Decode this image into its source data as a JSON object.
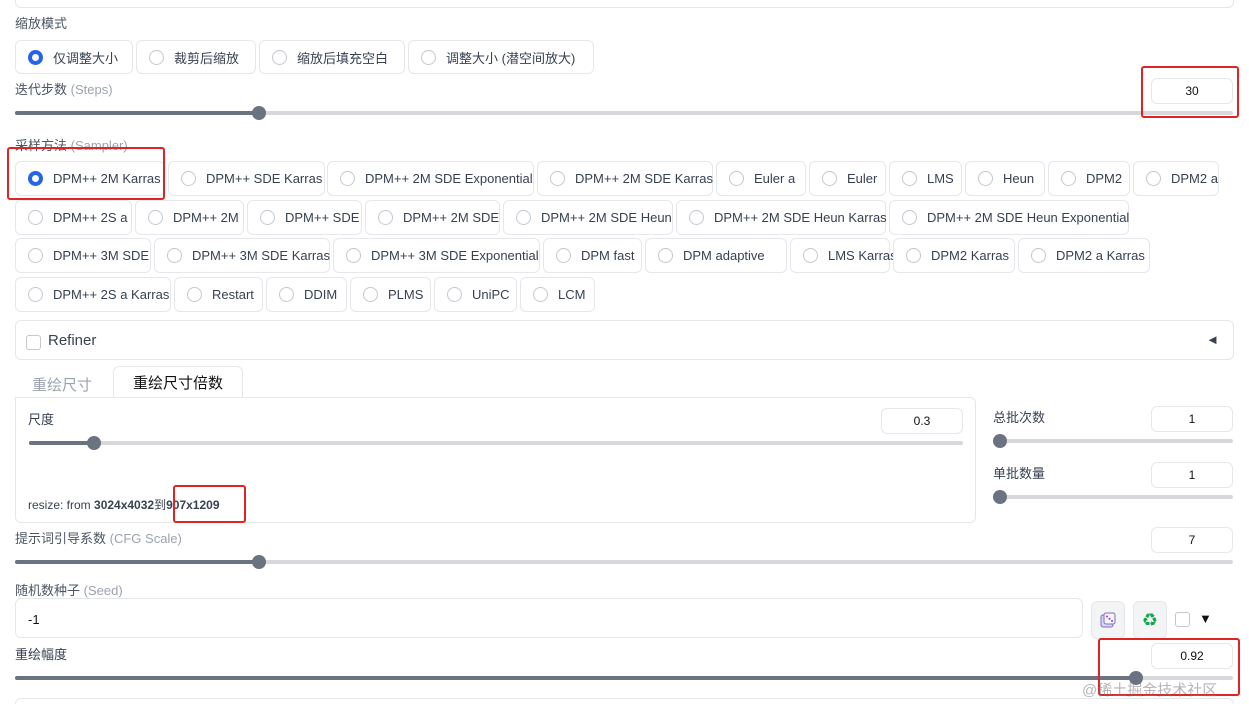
{
  "resize_mode": {
    "label": "缩放模式",
    "options": [
      "仅调整大小",
      "裁剪后缩放",
      "缩放后填充空白",
      "调整大小 (潜空间放大)"
    ],
    "selected": 0
  },
  "steps": {
    "label": "迭代步数",
    "label_en": "(Steps)",
    "value": "30",
    "fraction": 0.2
  },
  "sampler": {
    "label": "采样方法",
    "label_en": "(Sampler)",
    "selected": "DPM++ 2M Karras",
    "rows": [
      [
        "DPM++ 2M Karras",
        "DPM++ SDE Karras",
        "DPM++ 2M SDE Exponential",
        "DPM++ 2M SDE Karras",
        "Euler a",
        "Euler",
        "LMS",
        "Heun",
        "DPM2",
        "DPM2 a"
      ],
      [
        "DPM++ 2S a",
        "DPM++ 2M",
        "DPM++ SDE",
        "DPM++ 2M SDE",
        "DPM++ 2M SDE Heun",
        "DPM++ 2M SDE Heun Karras",
        "DPM++ 2M SDE Heun Exponential"
      ],
      [
        "DPM++ 3M SDE",
        "DPM++ 3M SDE Karras",
        "DPM++ 3M SDE Exponential",
        "DPM fast",
        "DPM adaptive",
        "LMS Karras",
        "DPM2 Karras",
        "DPM2 a Karras"
      ],
      [
        "DPM++ 2S a Karras",
        "Restart",
        "DDIM",
        "PLMS",
        "UniPC",
        "LCM"
      ]
    ]
  },
  "refiner": {
    "label": "Refiner",
    "arrow": "◄"
  },
  "tabs": [
    "重绘尺寸",
    "重绘尺寸倍数"
  ],
  "active_tab": 1,
  "scale": {
    "label": "尺度",
    "value": "0.3",
    "fraction": 0.07
  },
  "resize_info": {
    "prefix": "resize: from ",
    "from": "3024x4032",
    "mid": "到",
    "to": "907x1209"
  },
  "batch_count": {
    "label": "总批次数",
    "value": "1",
    "fraction": 0
  },
  "batch_size": {
    "label": "单批数量",
    "value": "1",
    "fraction": 0
  },
  "cfg": {
    "label": "提示词引导系数",
    "label_en": "(CFG Scale)",
    "value": "7",
    "fraction": 0.2
  },
  "seed": {
    "label": "随机数种子",
    "label_en": "(Seed)",
    "value": "-1",
    "dropdown": "▼"
  },
  "denoise": {
    "label": "重绘幅度",
    "value": "0.92",
    "fraction": 0.92
  },
  "watermark": "@稀土掘金技术社区",
  "colors": {
    "accent": "#2563eb",
    "highlight": "#e02424",
    "slider": "#6b7280"
  }
}
